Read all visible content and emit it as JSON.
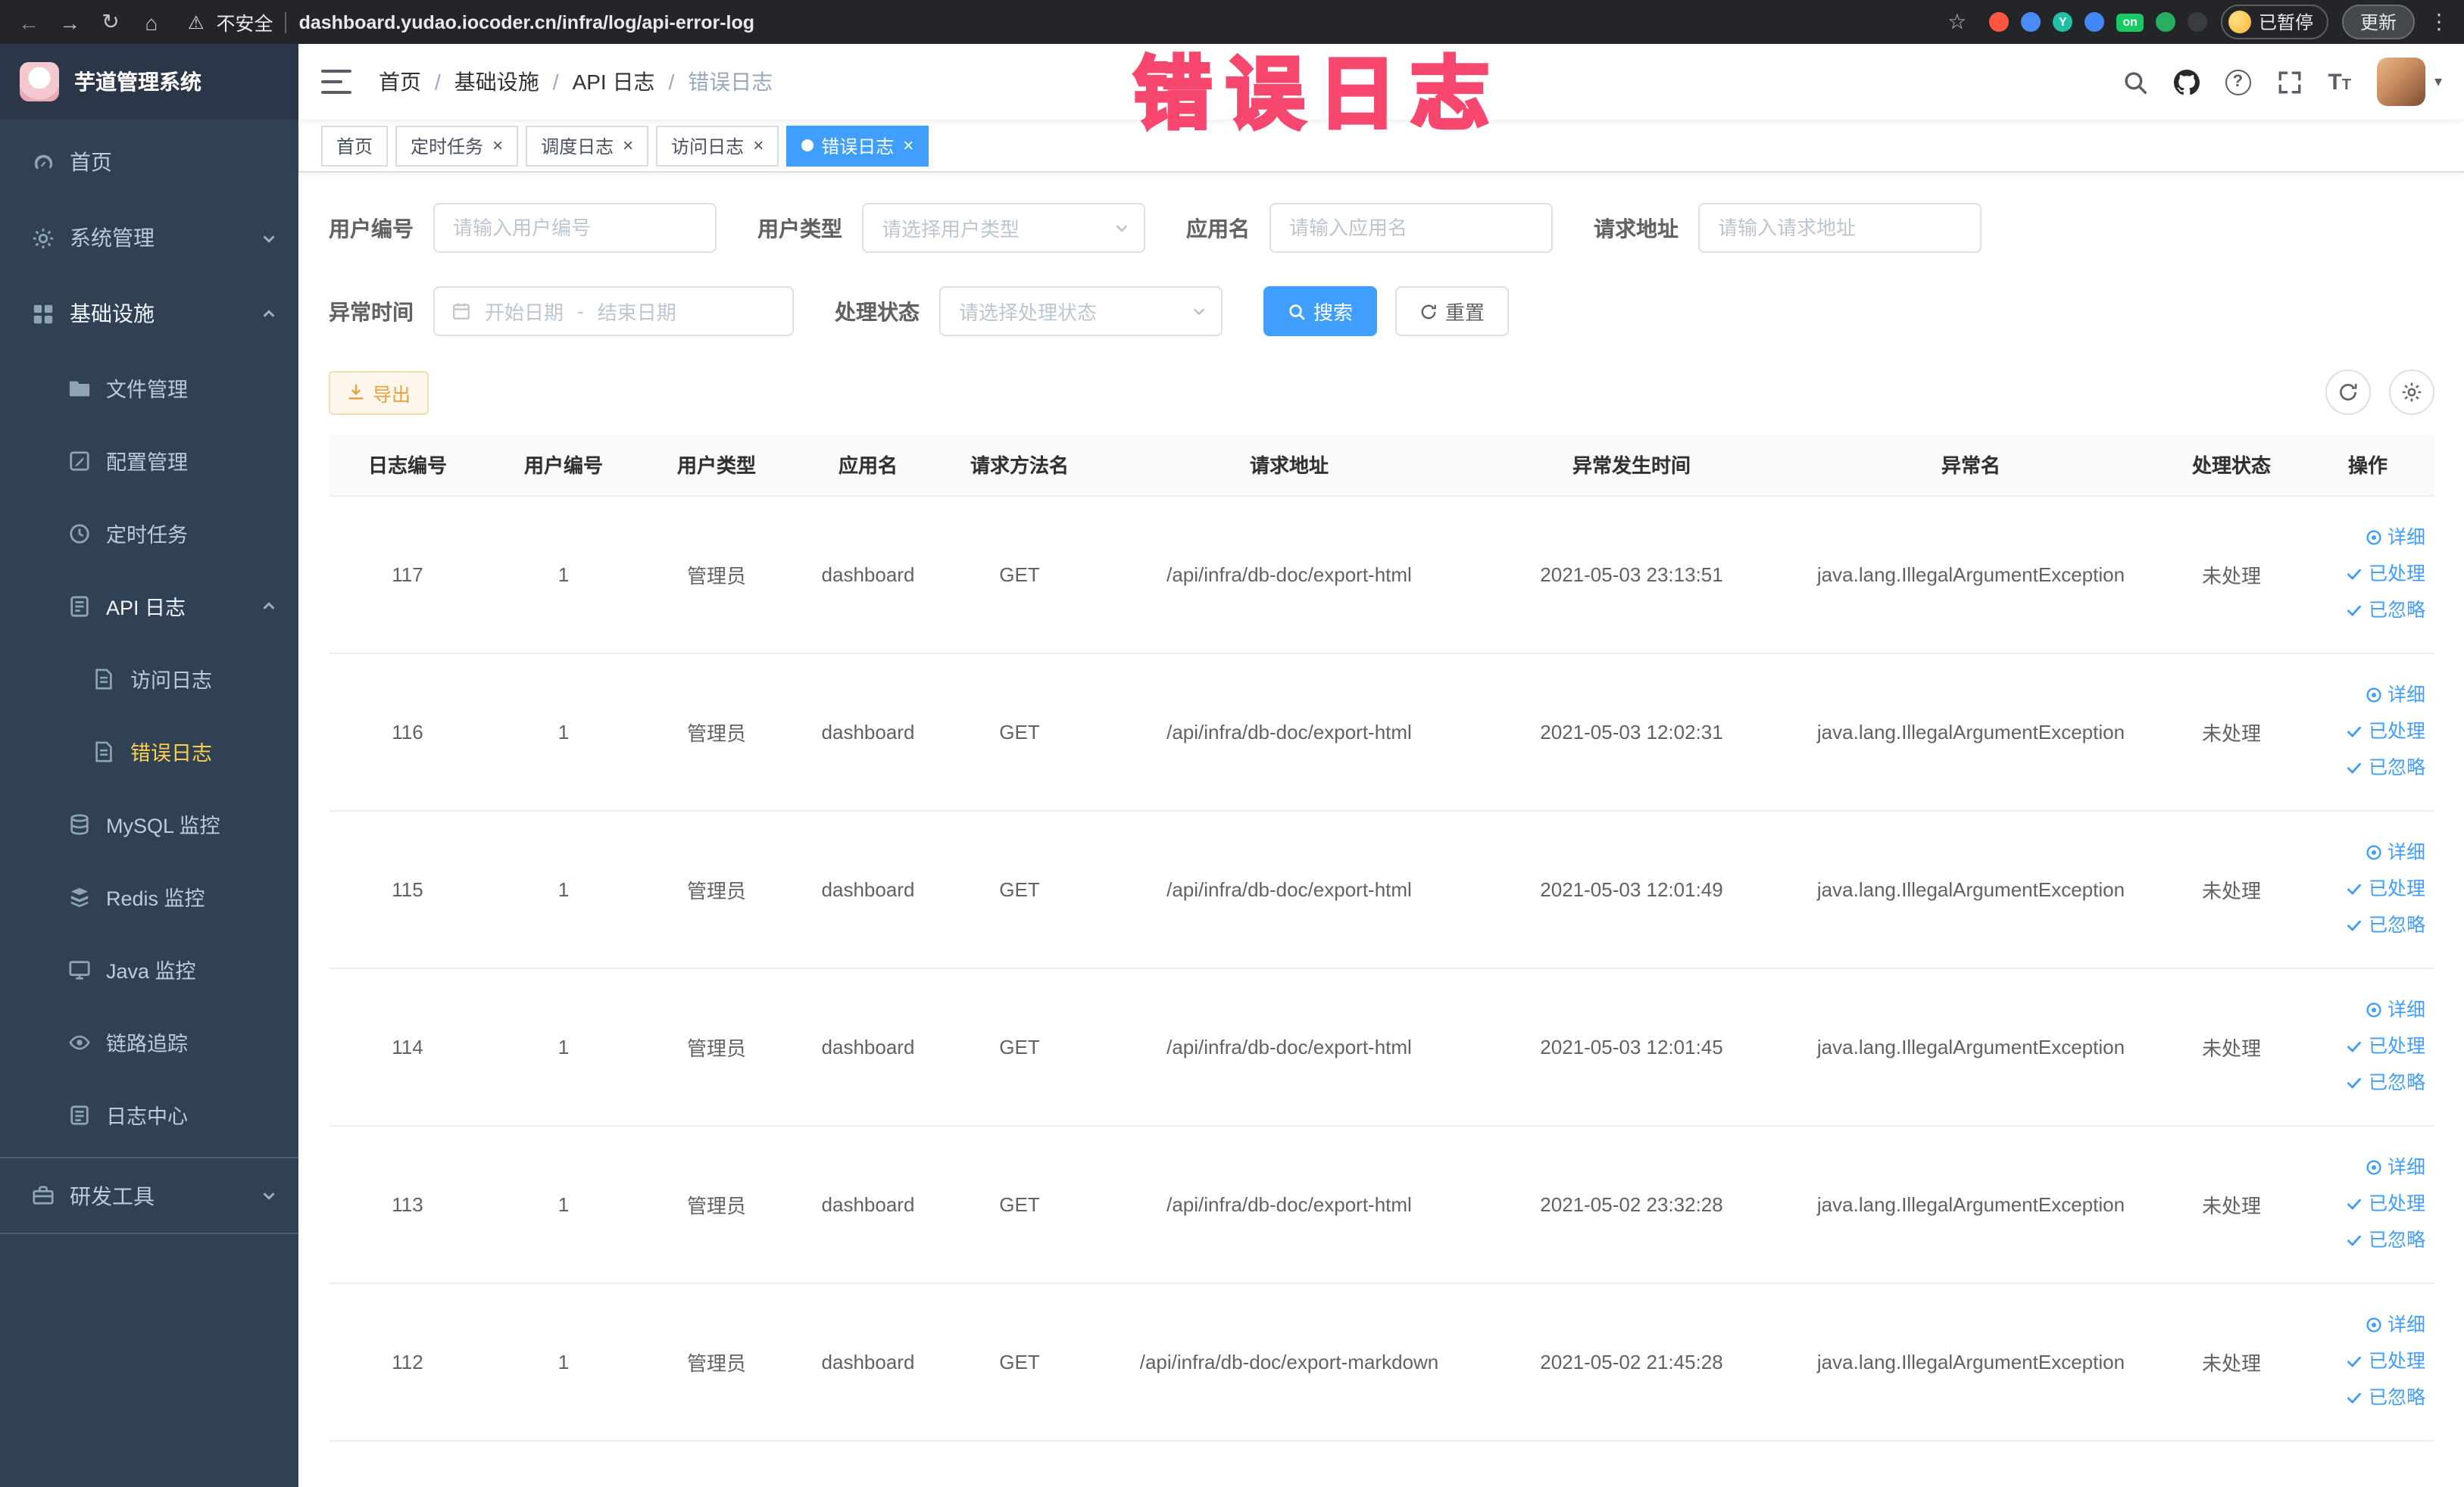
{
  "colors": {
    "accent": "#409eff",
    "sidebar_bg": "#304156",
    "active_menu": "#ffd04b",
    "watermark_pink": "#f8476e",
    "warning": "#e6a23c"
  },
  "watermark_text": "错误日志",
  "browser": {
    "security_label": "不安全",
    "url": "dashboard.yudao.iocoder.cn/infra/log/api-error-log",
    "paused_badge": "已暂停",
    "update_button": "更新",
    "extensions": [
      {
        "color": "#ff5542"
      },
      {
        "color": "#4c8bf5"
      },
      {
        "color": "#21c0a5",
        "label": "Y"
      },
      {
        "color": "#4285f4"
      },
      {
        "color": "#18c964",
        "label": "on"
      },
      {
        "color": "#27ae60"
      },
      {
        "color": "#3a3d40"
      }
    ]
  },
  "sidebar": {
    "logo_title": "芋道管理系统",
    "items": [
      {
        "key": "home",
        "level": 1,
        "icon": "dashboard",
        "label": "首页"
      },
      {
        "key": "system",
        "level": 1,
        "icon": "gear",
        "label": "系统管理",
        "chevron": "down"
      },
      {
        "key": "infra",
        "level": 1,
        "icon": "infra",
        "label": "基础设施",
        "chevron": "up",
        "ancestor": true
      },
      {
        "key": "file",
        "level": 2,
        "icon": "folder",
        "label": "文件管理"
      },
      {
        "key": "config",
        "level": 2,
        "icon": "edit",
        "label": "配置管理"
      },
      {
        "key": "job",
        "level": 2,
        "icon": "clock",
        "label": "定时任务"
      },
      {
        "key": "api-log",
        "level": 2,
        "icon": "apilog",
        "label": "API 日志",
        "chevron": "up",
        "ancestor": true
      },
      {
        "key": "access-log",
        "level": 3,
        "icon": "doc",
        "label": "访问日志"
      },
      {
        "key": "error-log",
        "level": 3,
        "icon": "doc",
        "label": "错误日志",
        "active": true
      },
      {
        "key": "mysql",
        "level": 2,
        "icon": "db",
        "label": "MySQL 监控"
      },
      {
        "key": "redis",
        "level": 2,
        "icon": "redis",
        "label": "Redis 监控"
      },
      {
        "key": "java",
        "level": 2,
        "icon": "monitor",
        "label": "Java 监控"
      },
      {
        "key": "trace",
        "level": 2,
        "icon": "eye",
        "label": "链路追踪"
      },
      {
        "key": "log-center",
        "level": 2,
        "icon": "logcenter",
        "label": "日志中心"
      },
      {
        "key": "dev-tools",
        "level": 1,
        "icon": "tools",
        "label": "研发工具",
        "chevron": "down",
        "separated": true
      }
    ]
  },
  "navbar": {
    "breadcrumb": [
      "首页",
      "基础设施",
      "API 日志",
      "错误日志"
    ]
  },
  "tabs": [
    {
      "label": "首页",
      "closable": false,
      "active": false
    },
    {
      "label": "定时任务",
      "closable": true,
      "active": false
    },
    {
      "label": "调度日志",
      "closable": true,
      "active": false
    },
    {
      "label": "访问日志",
      "closable": true,
      "active": false
    },
    {
      "label": "错误日志",
      "closable": true,
      "active": true
    }
  ],
  "filters": {
    "user_id": {
      "label": "用户编号",
      "placeholder": "请输入用户编号"
    },
    "user_type": {
      "label": "用户类型",
      "placeholder": "请选择用户类型"
    },
    "app_name": {
      "label": "应用名",
      "placeholder": "请输入应用名"
    },
    "request_url": {
      "label": "请求地址",
      "placeholder": "请输入请求地址"
    },
    "exception_time": {
      "label": "异常时间",
      "start_placeholder": "开始日期",
      "separator": "-",
      "end_placeholder": "结束日期"
    },
    "process_status": {
      "label": "处理状态",
      "placeholder": "请选择处理状态"
    },
    "search_button": "搜索",
    "reset_button": "重置"
  },
  "toolbar": {
    "export_button": "导出"
  },
  "table": {
    "columns": [
      "日志编号",
      "用户编号",
      "用户类型",
      "应用名",
      "请求方法名",
      "请求地址",
      "异常发生时间",
      "异常名",
      "处理状态",
      "操作"
    ],
    "actions": [
      "详细",
      "已处理",
      "已忽略"
    ],
    "rows": [
      {
        "id": "117",
        "user_id": "1",
        "user_type": "管理员",
        "app": "dashboard",
        "method": "GET",
        "url": "/api/infra/db-doc/export-html",
        "time": "2021-05-03 23:13:51",
        "exception": "java.lang.IllegalArgumentException",
        "status": "未处理"
      },
      {
        "id": "116",
        "user_id": "1",
        "user_type": "管理员",
        "app": "dashboard",
        "method": "GET",
        "url": "/api/infra/db-doc/export-html",
        "time": "2021-05-03 12:02:31",
        "exception": "java.lang.IllegalArgumentException",
        "status": "未处理"
      },
      {
        "id": "115",
        "user_id": "1",
        "user_type": "管理员",
        "app": "dashboard",
        "method": "GET",
        "url": "/api/infra/db-doc/export-html",
        "time": "2021-05-03 12:01:49",
        "exception": "java.lang.IllegalArgumentException",
        "status": "未处理"
      },
      {
        "id": "114",
        "user_id": "1",
        "user_type": "管理员",
        "app": "dashboard",
        "method": "GET",
        "url": "/api/infra/db-doc/export-html",
        "time": "2021-05-03 12:01:45",
        "exception": "java.lang.IllegalArgumentException",
        "status": "未处理"
      },
      {
        "id": "113",
        "user_id": "1",
        "user_type": "管理员",
        "app": "dashboard",
        "method": "GET",
        "url": "/api/infra/db-doc/export-html",
        "time": "2021-05-02 23:32:28",
        "exception": "java.lang.IllegalArgumentException",
        "status": "未处理"
      },
      {
        "id": "112",
        "user_id": "1",
        "user_type": "管理员",
        "app": "dashboard",
        "method": "GET",
        "url": "/api/infra/db-doc/export-markdown",
        "time": "2021-05-02 21:45:28",
        "exception": "java.lang.IllegalArgumentException",
        "status": "未处理"
      }
    ]
  }
}
